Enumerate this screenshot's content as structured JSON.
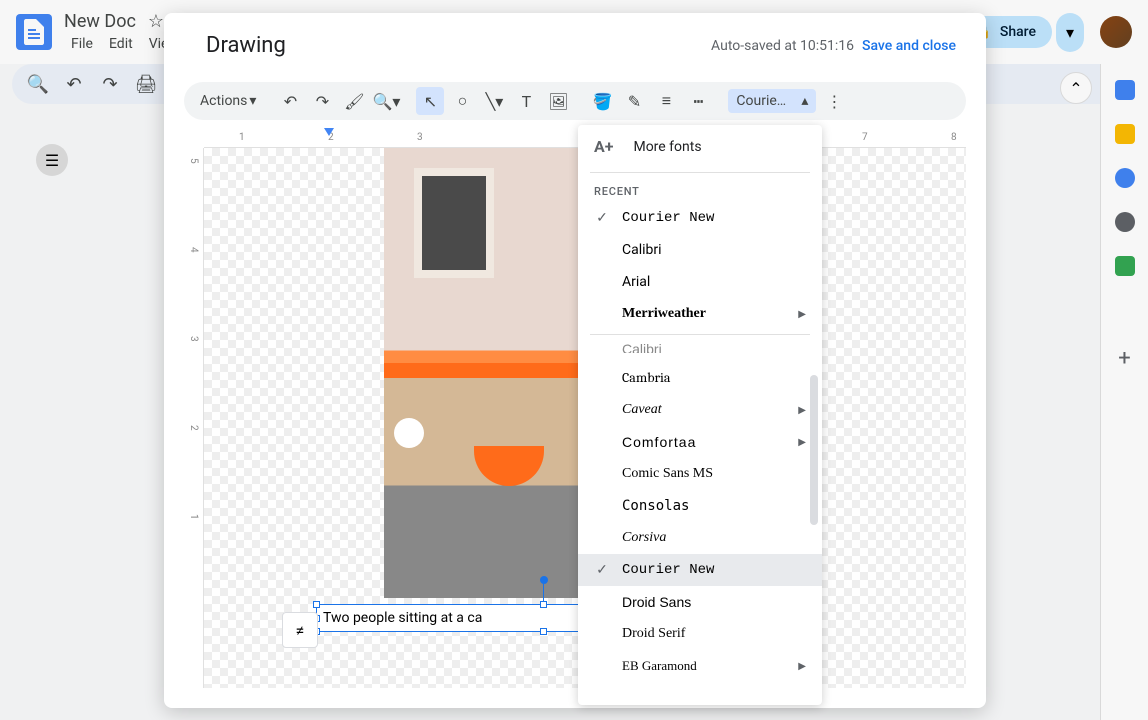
{
  "app": {
    "doc_title": "New Doc",
    "menus": [
      "File",
      "Edit",
      "View"
    ],
    "share_label": "Share"
  },
  "drawing": {
    "title": "Drawing",
    "autosave": "Auto-saved at 10:51:16",
    "save_close": "Save and close",
    "actions_label": "Actions",
    "font_selected": "Courie…",
    "text_content": "Two people sitting at a ca"
  },
  "ruler": {
    "h": [
      "1",
      "2",
      "3",
      "7",
      "8"
    ],
    "v": [
      "5",
      "4",
      "3",
      "2",
      "1"
    ]
  },
  "font_menu": {
    "more_fonts": "More fonts",
    "recent_label": "RECENT",
    "recent": [
      {
        "name": "Courier New",
        "class": "font-courier",
        "checked": true
      },
      {
        "name": "Calibri",
        "class": ""
      },
      {
        "name": "Arial",
        "class": ""
      },
      {
        "name": "Merriweather",
        "class": "font-merri",
        "submenu": true
      }
    ],
    "all": [
      {
        "name": "Calibri",
        "class": "font-calibri-cut"
      },
      {
        "name": "Cambria",
        "class": "font-cambria"
      },
      {
        "name": "Caveat",
        "class": "font-caveat",
        "submenu": true
      },
      {
        "name": "Comfortaa",
        "class": "font-comfortaa",
        "submenu": true
      },
      {
        "name": "Comic Sans MS",
        "class": "font-comic"
      },
      {
        "name": "Consolas",
        "class": "font-consolas"
      },
      {
        "name": "Corsiva",
        "class": "font-corsiva"
      },
      {
        "name": "Courier New",
        "class": "font-courier",
        "checked": true,
        "selected": true
      },
      {
        "name": "Droid Sans",
        "class": "font-droidsans"
      },
      {
        "name": "Droid Serif",
        "class": "font-droidserif"
      },
      {
        "name": "EB Garamond",
        "class": "font-garamond",
        "submenu": true
      }
    ]
  }
}
